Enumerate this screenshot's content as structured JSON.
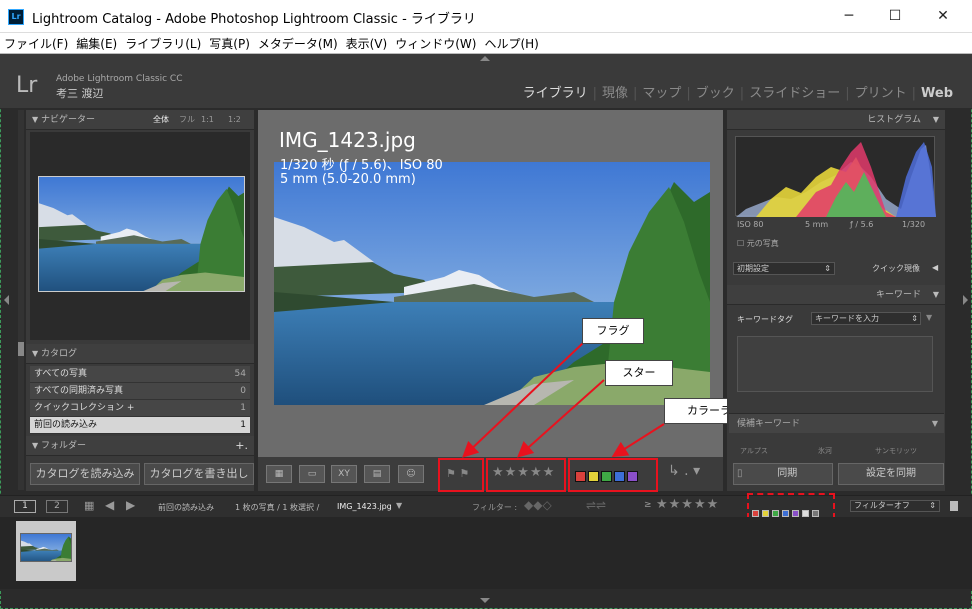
{
  "window": {
    "title": "Lightroom Catalog - Adobe Photoshop Lightroom Classic - ライブラリ",
    "app_icon": "Lr",
    "minimize": "─",
    "maximize": "☐",
    "close": "✕"
  },
  "menu": [
    "ファイル(F)",
    "編集(E)",
    "ライブラリ(L)",
    "写真(P)",
    "メタデータ(M)",
    "表示(V)",
    "ウィンドウ(W)",
    "ヘルプ(H)"
  ],
  "identity": {
    "logo": "Lr",
    "product": "Adobe Lightroom Classic CC",
    "user": "考三 渡辺"
  },
  "modules": [
    {
      "label": "ライブラリ",
      "active": true
    },
    {
      "label": "現像"
    },
    {
      "label": "マップ"
    },
    {
      "label": "ブック"
    },
    {
      "label": "スライドショー"
    },
    {
      "label": "プリント"
    },
    {
      "label": "Web"
    }
  ],
  "navigator": {
    "title": "ナビゲーター",
    "zoom": [
      "全体",
      "フル",
      "1:1",
      "1:2"
    ]
  },
  "catalog": {
    "title": "カタログ",
    "rows": [
      {
        "label": "すべての写真",
        "count": "54"
      },
      {
        "label": "すべての同期済み写真",
        "count": "0"
      },
      {
        "label": "クイックコレクション +",
        "count": "1"
      },
      {
        "label": "前回の読み込み",
        "count": "1",
        "selected": true
      }
    ]
  },
  "folders": {
    "title": "フォルダー",
    "add": "+."
  },
  "left_buttons": {
    "import": "カタログを読み込み",
    "export": "カタログを書き出し"
  },
  "photo_overlay": {
    "filename": "IMG_1423.jpg",
    "exposure": "1/320 秒 (ƒ / 5.6)、ISO 80",
    "lens": "5 mm (5.0-20.0 mm)"
  },
  "histogram": {
    "title": "ヒストグラム",
    "iso": "ISO 80",
    "focal": "5 mm",
    "aperture": "ƒ / 5.6",
    "shutter": "1/320",
    "original": "元の写真"
  },
  "quick_develop": {
    "preset": "初期設定",
    "label": "クイック現像"
  },
  "keywords": {
    "title": "キーワード",
    "tag_label": "キーワードタグ",
    "placeholder": "キーワードを入力",
    "suggest_fragment": "候補キーワード",
    "s1": "アルプス",
    "s2": "氷河",
    "s3": "サンモリッツ"
  },
  "right_buttons": {
    "sync": "同期",
    "sync_settings": "設定を同期"
  },
  "toolbar": {
    "stars": "★★★★★",
    "color_labels": [
      "#d9413c",
      "#e3d23a",
      "#3fa845",
      "#3d6fd6",
      "#8a4fc9"
    ]
  },
  "callouts": {
    "flag": "フラグ",
    "star": "スター",
    "color": "カラーラベル"
  },
  "filmbar": {
    "view1": "1",
    "view2": "2",
    "source": "前回の読み込み",
    "info": "1 枚の写真 / 1 枚選択 /",
    "file": "IMG_1423.jpg",
    "filter_label": "フィルター :",
    "gte": "≥",
    "stars": "★★★★★",
    "filter_off": "フィルターオフ",
    "filter_colors": [
      "#d9413c",
      "#e3d23a",
      "#3fa845",
      "#3d6fd6",
      "#8a4fc9",
      "#dddddd",
      "#777777"
    ]
  },
  "colors": {
    "callout_border": "#e8121e",
    "panel": "#3a3a3a",
    "background": "#2b2b2b"
  }
}
